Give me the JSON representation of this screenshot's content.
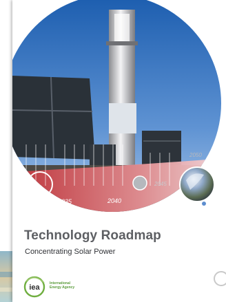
{
  "cover": {
    "title": "Technology Roadmap",
    "subtitle": "Concentrating Solar Power",
    "logo": {
      "acronym": "iea",
      "line1": "International",
      "line2": "Energy Agency"
    },
    "timeline": {
      "years": [
        "2035",
        "2040",
        "2045",
        "2050"
      ],
      "accent_color": "#c9343a"
    }
  },
  "icons": {
    "background_photo": "sea-photo",
    "tower_photo": "solar-power-tower-photo",
    "marble_photo": "iridescent-sphere-photo",
    "nav": "circle-nav-icon"
  }
}
